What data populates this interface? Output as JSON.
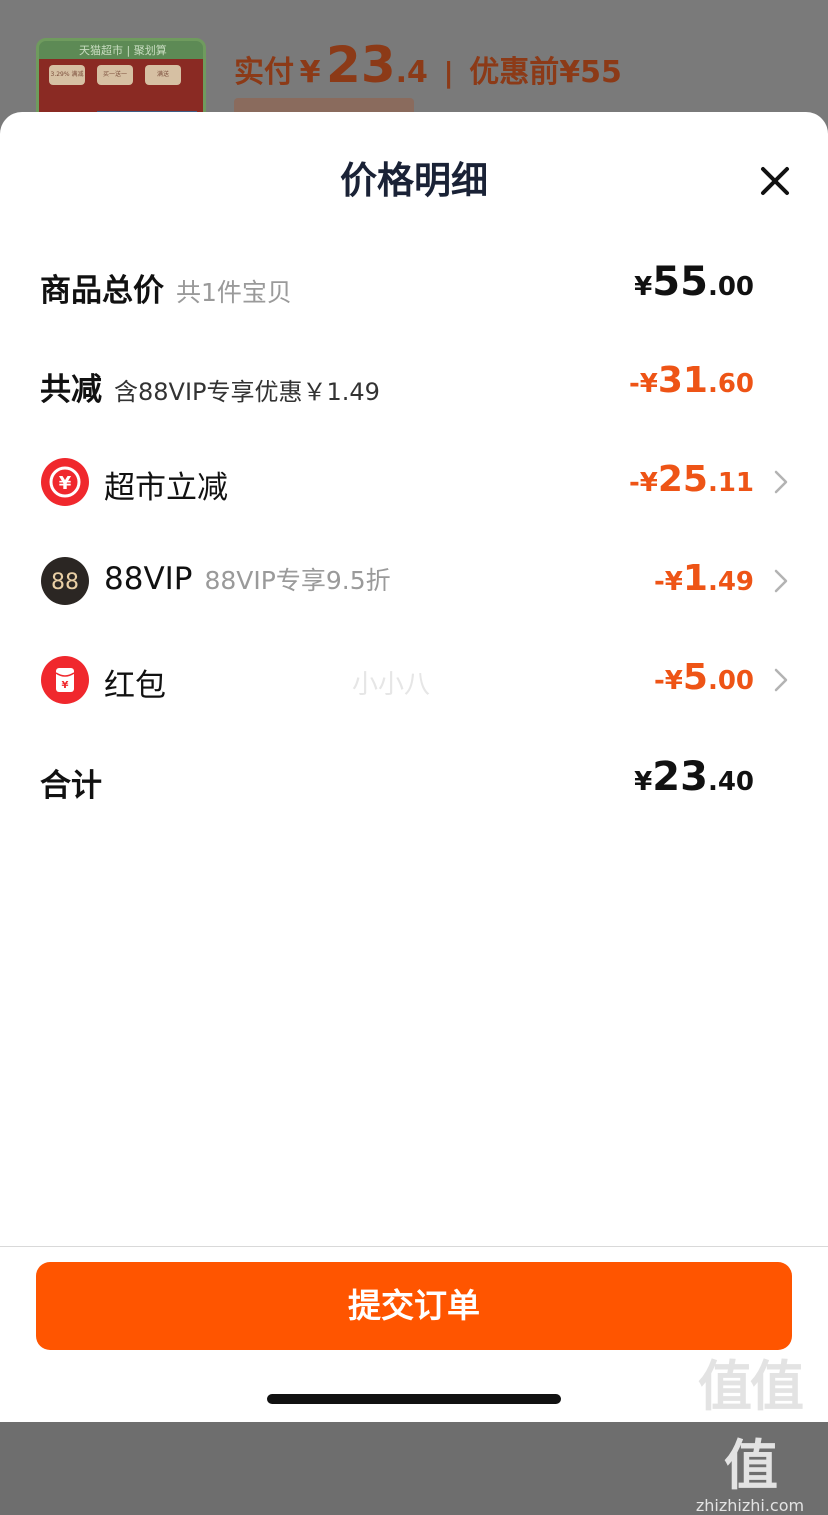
{
  "background": {
    "thumbnail_caption": "天猫超市 | 聚划算",
    "thumbnail_pills": [
      "3.29%\n满减券",
      "买一送一",
      "满送"
    ],
    "price_label": "实付",
    "price_symbol": "¥",
    "price_int": "23",
    "price_dec": ".4",
    "separator": "|",
    "orig_label": "优惠前",
    "orig_value": "¥55"
  },
  "sheet": {
    "title": "价格明细",
    "rows": [
      {
        "label": "商品总价",
        "sub": "共1件宝贝",
        "symbol": "¥",
        "int": "55",
        "dec": ".00"
      },
      {
        "label": "共减",
        "sub": "含88VIP专享优惠￥1.49",
        "symbol": "-¥",
        "int": "31",
        "dec": ".60"
      },
      {
        "label": "超市立减",
        "sub": "",
        "symbol": "-¥",
        "int": "25",
        "dec": ".11"
      },
      {
        "label": "88VIP",
        "sub": "88VIP专享9.5折",
        "symbol": "-¥",
        "int": "1",
        "dec": ".49"
      },
      {
        "label": "红包",
        "sub": "",
        "symbol": "-¥",
        "int": "5",
        "dec": ".00"
      },
      {
        "label": "合计",
        "sub": "",
        "symbol": "¥",
        "int": "23",
        "dec": ".40"
      }
    ],
    "icons": {
      "supermarket": {
        "name": "supermarket-discount-icon",
        "glyph": "¥",
        "color": "#f0282d"
      },
      "vip": {
        "name": "88vip-icon",
        "glyph": "88",
        "color": "#2b2623",
        "glyph_color": "#e9cfa5"
      },
      "redpacket": {
        "name": "red-packet-icon",
        "glyph": "¥",
        "color": "#f0282d"
      }
    },
    "submit_label": "提交订单",
    "watermark_mid": "小小八",
    "watermark_logo": "值值值",
    "watermark_site": "zhizhizhi.com"
  },
  "colors": {
    "accent": "#ff5500",
    "discount": "#ee5416",
    "title": "#1a2236"
  }
}
